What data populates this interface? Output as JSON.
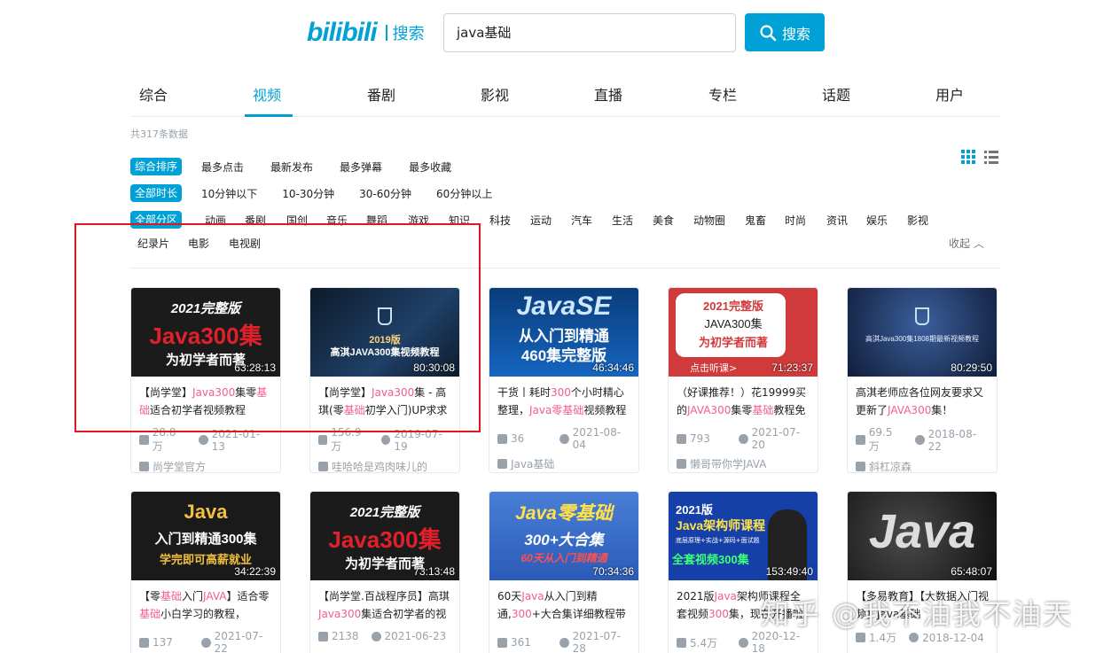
{
  "header": {
    "logo_text": "bilibili",
    "logo_suffix": "搜索",
    "search_value": "java基础",
    "search_button": "搜索"
  },
  "tabs": [
    "综合",
    "视频",
    "番剧",
    "影视",
    "直播",
    "专栏",
    "话题",
    "用户"
  ],
  "active_tab": "视频",
  "total_text": "共317条数据",
  "sort": {
    "active": "综合排序",
    "options": [
      "最多点击",
      "最新发布",
      "最多弹幕",
      "最多收藏"
    ]
  },
  "duration": {
    "active": "全部时长",
    "options": [
      "10分钟以下",
      "10-30分钟",
      "30-60分钟",
      "60分钟以上"
    ]
  },
  "zone": {
    "active": "全部分区",
    "options": [
      "动画",
      "番剧",
      "国创",
      "音乐",
      "舞蹈",
      "游戏",
      "知识",
      "科技",
      "运动",
      "汽车",
      "生活",
      "美食",
      "动物圈",
      "鬼畜",
      "时尚",
      "资讯",
      "娱乐",
      "影视"
    ],
    "options_row2": [
      "纪录片",
      "电影",
      "电视剧"
    ],
    "collapse": "收起"
  },
  "videos": [
    {
      "thumb_line1": "2021完整版",
      "thumb_line2": "Java300集",
      "thumb_line3": "为初学者而著",
      "duration": "63:28:13",
      "title_a": "【尚学堂】",
      "title_b": "Java300",
      "title_c": "集零",
      "title_d": "基",
      "title_e": "础",
      "title_f": "适合初学者视频教程",
      "plays": "28.8万",
      "date": "2021-01-13",
      "up": "尚学堂官方"
    },
    {
      "thumb_line1": "2019版",
      "thumb_line2": "高淇JAVA300集视频教程",
      "duration": "80:30:08",
      "title_a": "【尚学堂】",
      "title_b": "Java300",
      "title_c": "集 - 高琪(零",
      "title_d": "基础",
      "title_f": "初学入门)UP求求",
      "plays": "156.9万",
      "date": "2019-07-19",
      "up": "哇哈哈是鸡肉味儿的"
    },
    {
      "thumb_line1": "JavaSE",
      "thumb_line2": "从入门到精通",
      "thumb_line3": "460集完整版",
      "duration": "46:34:46",
      "title_a": "干货丨耗时",
      "title_b": "300",
      "title_c": "个小时精心整理，",
      "title_d": "Java",
      "title_e": "零基础",
      "title_f": "视频教程",
      "plays": "36",
      "date": "2021-08-04",
      "up": "Java基础"
    },
    {
      "thumb_line1": "2021完整版",
      "thumb_line2": "JAVA300集",
      "thumb_line3": "为初学者而著",
      "thumb_line4": "点击听课>",
      "duration": "71:23:37",
      "title_a": "（好课推荐！）花19999买的",
      "title_b": "JAVA300",
      "title_c": "集零",
      "title_d": "基础",
      "title_f": "教程免",
      "plays": "793",
      "date": "2021-07-20",
      "up": "懒哥带你学JAVA"
    },
    {
      "thumb_line1": "高淇Java300集1808期最新视频教程",
      "duration": "80:29:50",
      "title_a": "高淇老师应各位网友要求又更新了",
      "title_b": "JAVA300",
      "title_c": "集！",
      "plays": "69.5万",
      "date": "2018-08-22",
      "up": "斜杠凉森"
    },
    {
      "thumb_line1": "Java",
      "thumb_line2": "入门到精通300集",
      "thumb_line3": "学完即可高薪就业",
      "duration": "34:22:39",
      "title_a": "【零",
      "title_b": "基础",
      "title_c": "入门",
      "title_d": "JAVA",
      "title_e": "】适合零",
      "title_g": "基础",
      "title_f": "小白学习的教程，",
      "plays": "137",
      "date": "2021-07-22"
    },
    {
      "thumb_line1": "2021完整版",
      "thumb_line2": "Java300集",
      "thumb_line3": "为初学者而著",
      "duration": "73:13:48",
      "title_a": "【尚学堂.百战程序员】高琪",
      "title_b": "Java300",
      "title_c": "集适合初学者的视",
      "plays": "2138",
      "date": "2021-06-23"
    },
    {
      "thumb_line1": "Java零基础",
      "thumb_line2": "300+大合集",
      "thumb_line3": "60天从入门到精通",
      "duration": "70:34:36",
      "title_a": "60天",
      "title_b": "Java",
      "title_c": "从入门到精通,",
      "title_d": "300",
      "title_f": "+大合集详细教程带",
      "plays": "361",
      "date": "2021-07-28"
    },
    {
      "thumb_line1": "2021版",
      "thumb_line2": "Java架构师课程",
      "thumb_line3": "底层原理+实战+源码+面试题",
      "thumb_line4": "全套视频300集",
      "duration": "153:49:40",
      "title_a": "2021版",
      "title_b": "Java",
      "title_c": "架构师课程全套视频",
      "title_d": "300",
      "title_f": "集，现在开播啦",
      "plays": "5.4万",
      "date": "2020-12-18"
    },
    {
      "thumb_line1": "Java",
      "duration": "65:48:07",
      "title_a": "【多易教育】【大数据入门视频】Java基础",
      "plays": "1.4万",
      "date": "2018-12-04"
    }
  ],
  "watermark": "知乎 @我不油我不油天"
}
